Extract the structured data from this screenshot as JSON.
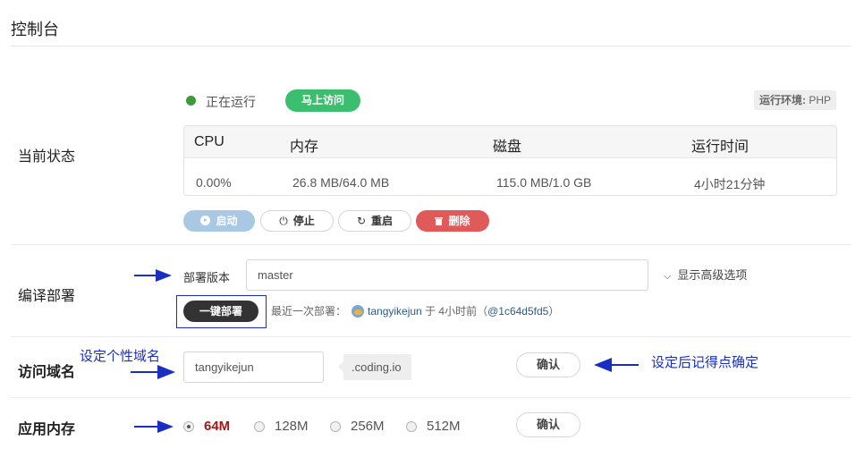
{
  "page_title": "控制台",
  "status_section": {
    "label": "当前状态",
    "status_text": "正在运行",
    "visit_button": "马上访问",
    "env_key": "运行环境:",
    "env_value": "PHP",
    "stats_headers": [
      "CPU",
      "内存",
      "磁盘",
      "运行时间"
    ],
    "stats_values": [
      "0.00%",
      "26.8 MB/64.0 MB",
      "115.0 MB/1.0 GB",
      "4小时21分钟"
    ],
    "buttons": {
      "start": "启动",
      "stop": "停止",
      "restart": "重启",
      "delete": "删除"
    },
    "colors": {
      "running": "#3c9a3c",
      "accent": "#3bbf6e",
      "danger": "#e05a5a"
    }
  },
  "deploy_section": {
    "label": "编译部署",
    "version_label": "部署版本",
    "branch_value": "master",
    "advanced_toggle": "显示高级选项",
    "deploy_button": "一键部署",
    "last_deploy_prefix": "最近一次部署：",
    "last_deploy_user": "tangyikejun",
    "last_deploy_time": "于 4小时前（",
    "last_deploy_hash": "@1c64d5fd5",
    "last_deploy_suffix": "）"
  },
  "domain_section": {
    "label": "访问域名",
    "annotation": "设定个性域名",
    "input_value": "tangyikejun",
    "suffix": ".coding.io",
    "confirm_button": "确认",
    "confirm_annotation": "设定后记得点确定"
  },
  "memory_section": {
    "label": "应用内存",
    "options": [
      "64M",
      "128M",
      "256M",
      "512M"
    ],
    "selected": "64M",
    "confirm_button": "确认"
  },
  "icons": [
    "start-play-icon",
    "power-icon",
    "refresh-icon",
    "trash-icon",
    "chevron-double-down-icon",
    "user-avatar",
    "annotation-arrow-icon"
  ]
}
